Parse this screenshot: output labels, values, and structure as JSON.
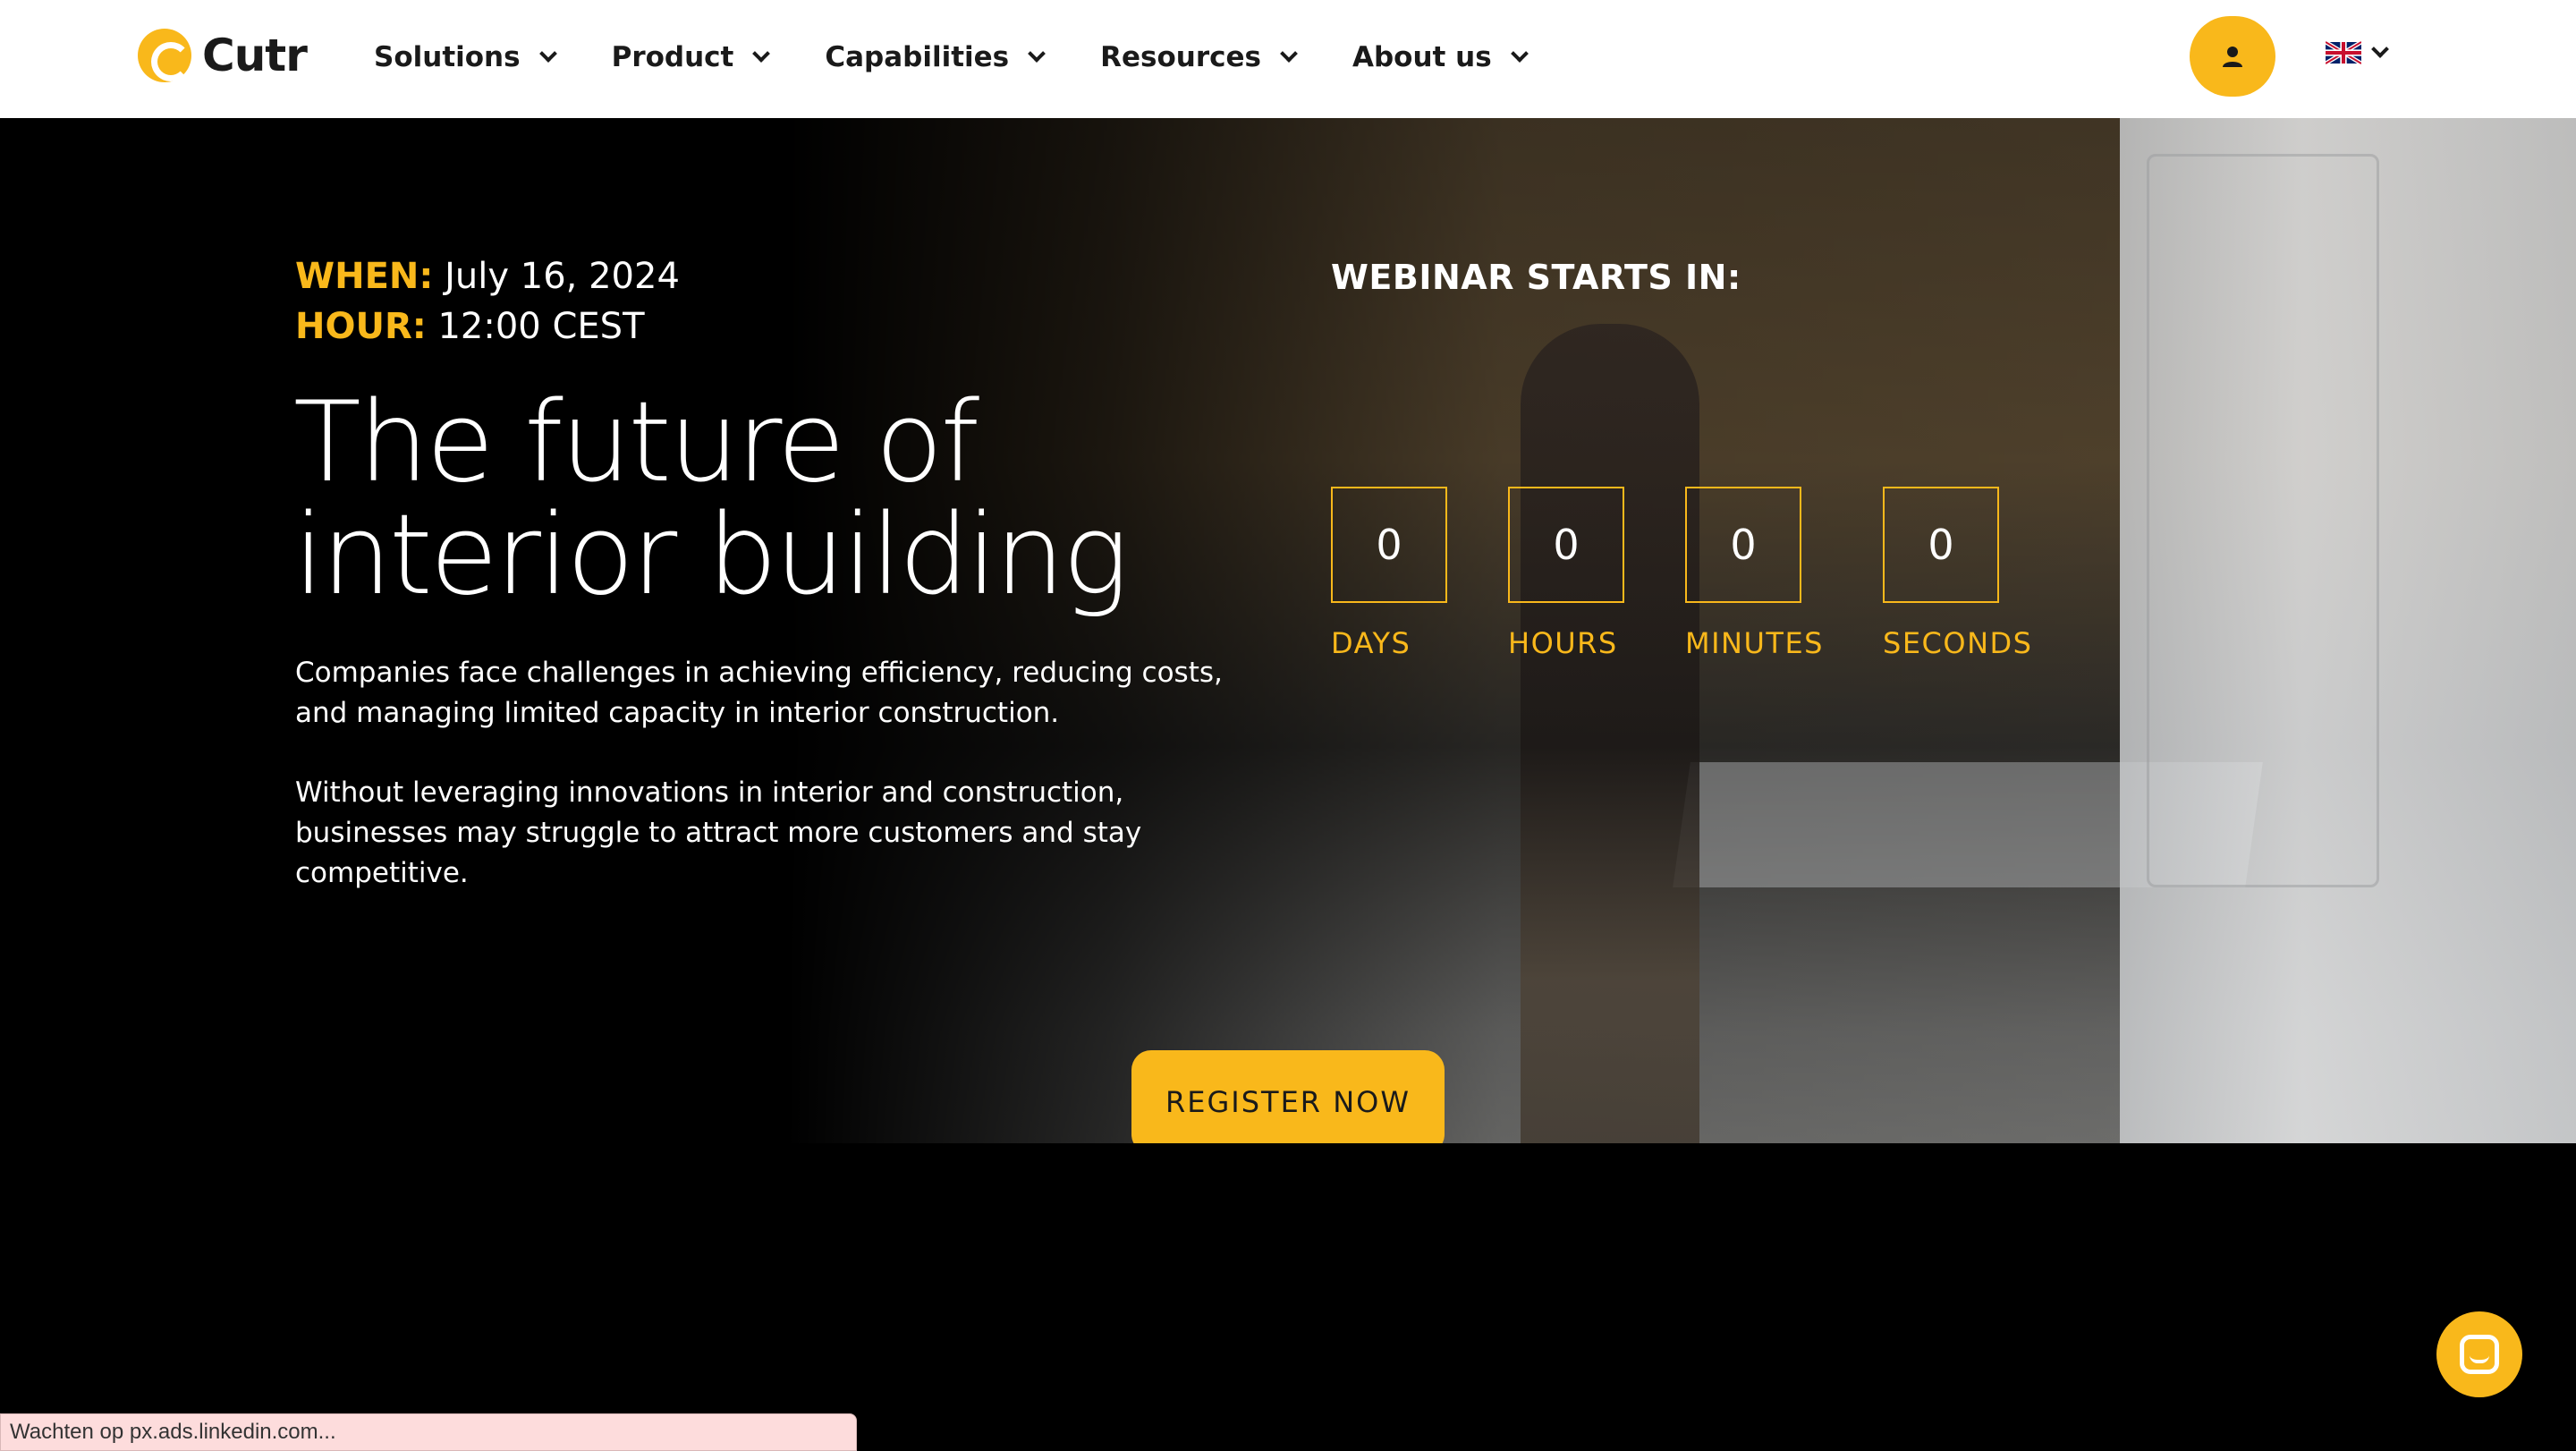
{
  "header": {
    "logo_text": "Cutr",
    "nav": [
      {
        "label": "Solutions"
      },
      {
        "label": "Product"
      },
      {
        "label": "Capabilities"
      },
      {
        "label": "Resources"
      },
      {
        "label": "About us"
      }
    ],
    "language_icon": "uk-flag-icon"
  },
  "hero": {
    "when_label": "WHEN:",
    "when_value": "July 16, 2024",
    "hour_label": "HOUR:",
    "hour_value": "12:00 CEST",
    "title_line1": "The future of",
    "title_line2": "interior building",
    "paragraph1": "Companies face challenges in achieving efficiency, reducing costs, and managing limited capacity in interior construction.",
    "paragraph2": "Without leveraging innovations in interior and construction, businesses may struggle to attract more customers and stay competitive.",
    "webinar_label": "WEBINAR STARTS IN:",
    "countdown": [
      {
        "value": "0",
        "label": "DAYS"
      },
      {
        "value": "0",
        "label": "HOURS"
      },
      {
        "value": "0",
        "label": "MINUTES"
      },
      {
        "value": "0",
        "label": "SECONDS"
      }
    ],
    "register_label": "REGISTER NOW"
  },
  "status_bar": {
    "text": "Wachten op px.ads.linkedin.com..."
  },
  "colors": {
    "accent": "#f9b81b",
    "background": "#000000",
    "header_bg": "#ffffff"
  }
}
